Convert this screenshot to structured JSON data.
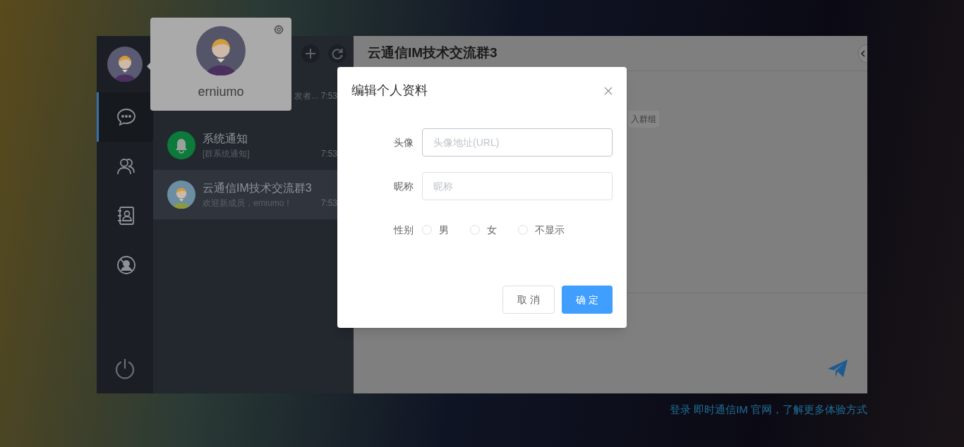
{
  "user": {
    "name": "erniumo"
  },
  "sidebar": {
    "items": [
      {
        "kind": "chat",
        "selected": true
      },
      {
        "kind": "contacts",
        "selected": false
      },
      {
        "kind": "address-book",
        "selected": false
      },
      {
        "kind": "blacklist",
        "selected": false
      }
    ]
  },
  "sessions": [
    {
      "kind": "hidden",
      "preview": "发者...",
      "time": "7:53",
      "selected": false
    },
    {
      "kind": "bell",
      "name": "系统通知",
      "preview": "[群系统通知]",
      "time": "7:53",
      "selected": false
    },
    {
      "kind": "group",
      "name": "云通信IM技术交流群3",
      "preview": "欢迎新成员，erniumo！",
      "time": "7:53",
      "selected": true
    }
  ],
  "chat": {
    "title": "云通信IM技术交流群3",
    "chip": "入群组"
  },
  "dialog": {
    "title": "编辑个人资料",
    "fields": [
      {
        "label": "头像",
        "placeholder": "头像地址(URL)"
      },
      {
        "label": "昵称",
        "placeholder": "昵称"
      }
    ],
    "gender": {
      "label": "性别",
      "options": [
        {
          "label": "男",
          "selected": false
        },
        {
          "label": "女",
          "selected": false
        },
        {
          "label": "不显示",
          "selected": false
        }
      ]
    },
    "buttons": [
      {
        "label": "取 消",
        "kind": "secondary"
      },
      {
        "label": "确 定",
        "kind": "primary"
      }
    ]
  },
  "footer_link": "登录 即时通信IM 官网，了解更多体验方式"
}
